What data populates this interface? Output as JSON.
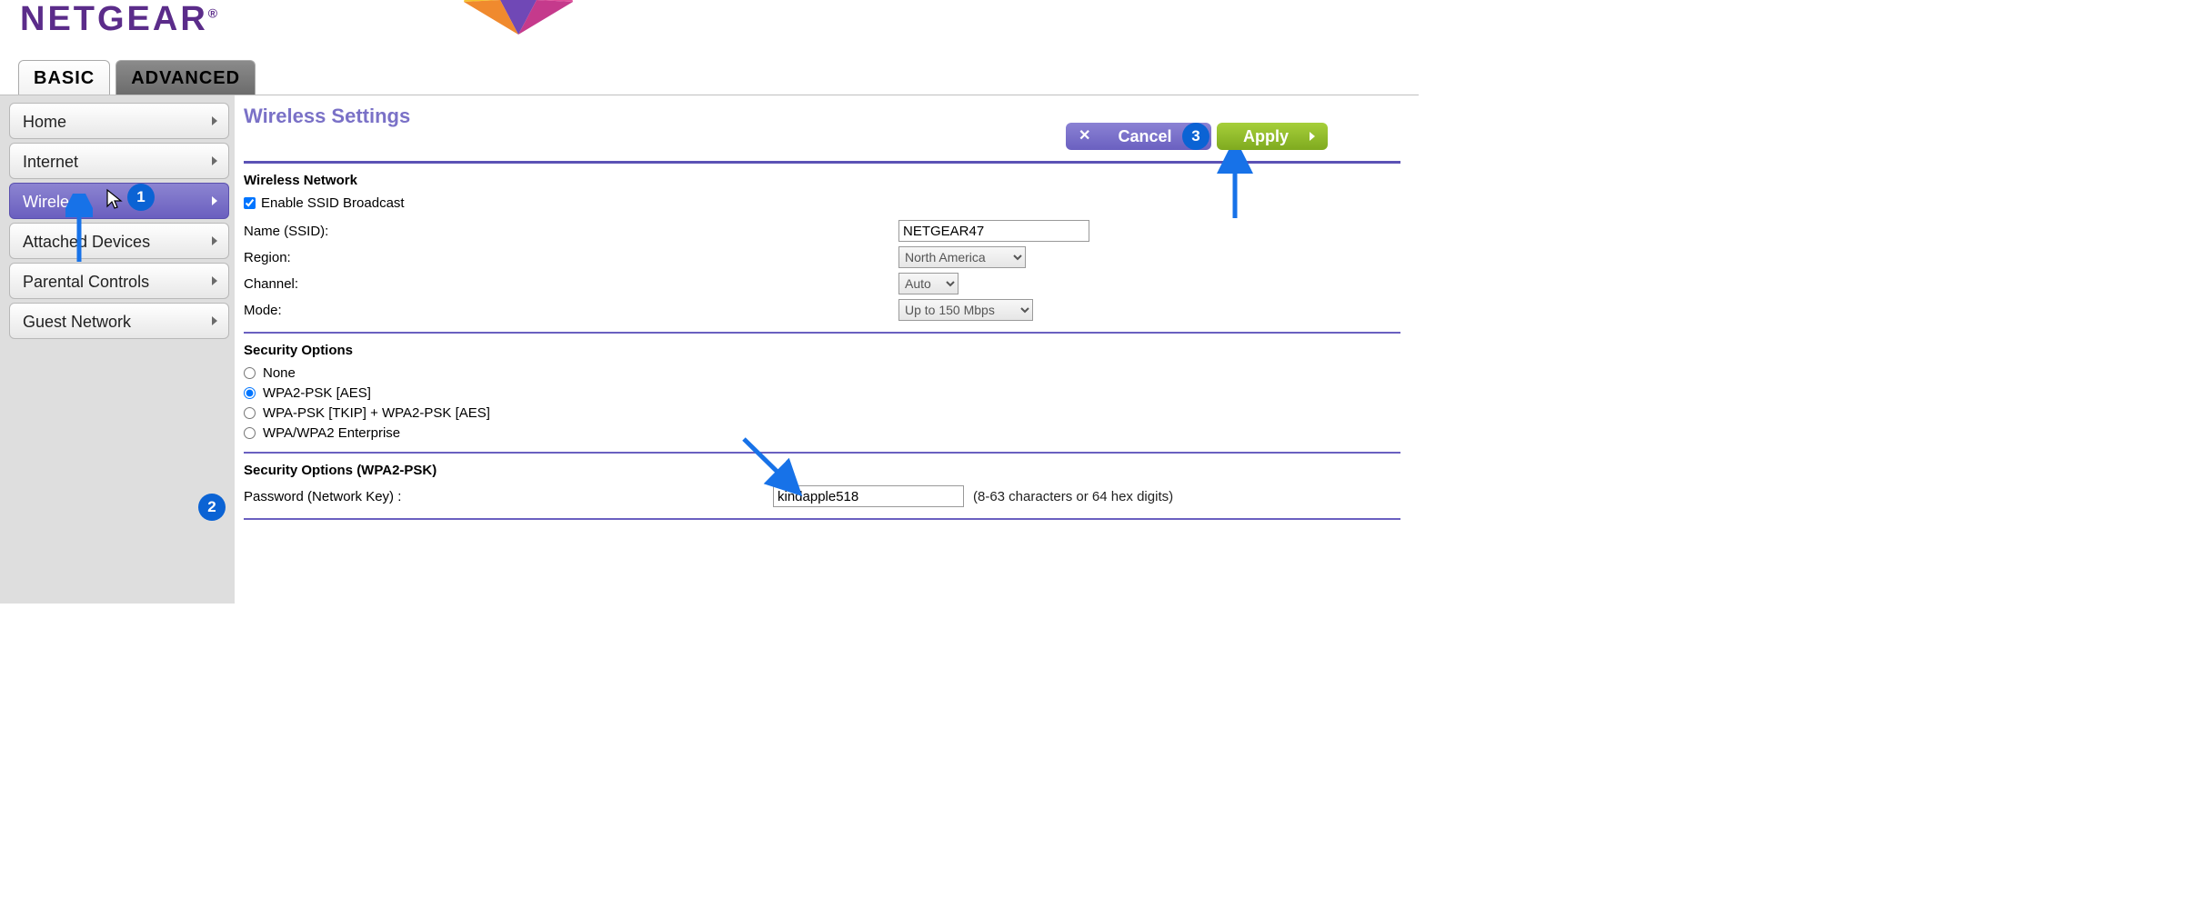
{
  "brand": "NETGEAR",
  "tabs": {
    "basic": "BASIC",
    "advanced": "ADVANCED"
  },
  "sidebar": {
    "items": [
      {
        "label": "Home"
      },
      {
        "label": "Internet"
      },
      {
        "label": "Wireless"
      },
      {
        "label": "Attached Devices"
      },
      {
        "label": "Parental Controls"
      },
      {
        "label": "Guest Network"
      }
    ]
  },
  "page": {
    "title": "Wireless Settings",
    "cancel": "Cancel",
    "apply": "Apply"
  },
  "wireless_network": {
    "heading": "Wireless Network",
    "ssid_broadcast_label": "Enable SSID Broadcast",
    "ssid_broadcast_checked": true,
    "name_label": "Name (SSID):",
    "name_value": "NETGEAR47",
    "region_label": "Region:",
    "region_value": "North America",
    "channel_label": "Channel:",
    "channel_value": "Auto",
    "mode_label": "Mode:",
    "mode_value": "Up to 150 Mbps"
  },
  "security_options": {
    "heading": "Security Options",
    "opts": [
      "None",
      "WPA2-PSK [AES]",
      "WPA-PSK [TKIP] + WPA2-PSK [AES]",
      "WPA/WPA2 Enterprise"
    ],
    "selected_index": 1
  },
  "wpa2": {
    "heading": "Security Options (WPA2-PSK)",
    "password_label": "Password (Network Key) :",
    "password_value": "kindapple518",
    "hint": "(8-63 characters or 64 hex digits)"
  },
  "annotations": {
    "step1": "1",
    "step2": "2",
    "step3": "3"
  }
}
